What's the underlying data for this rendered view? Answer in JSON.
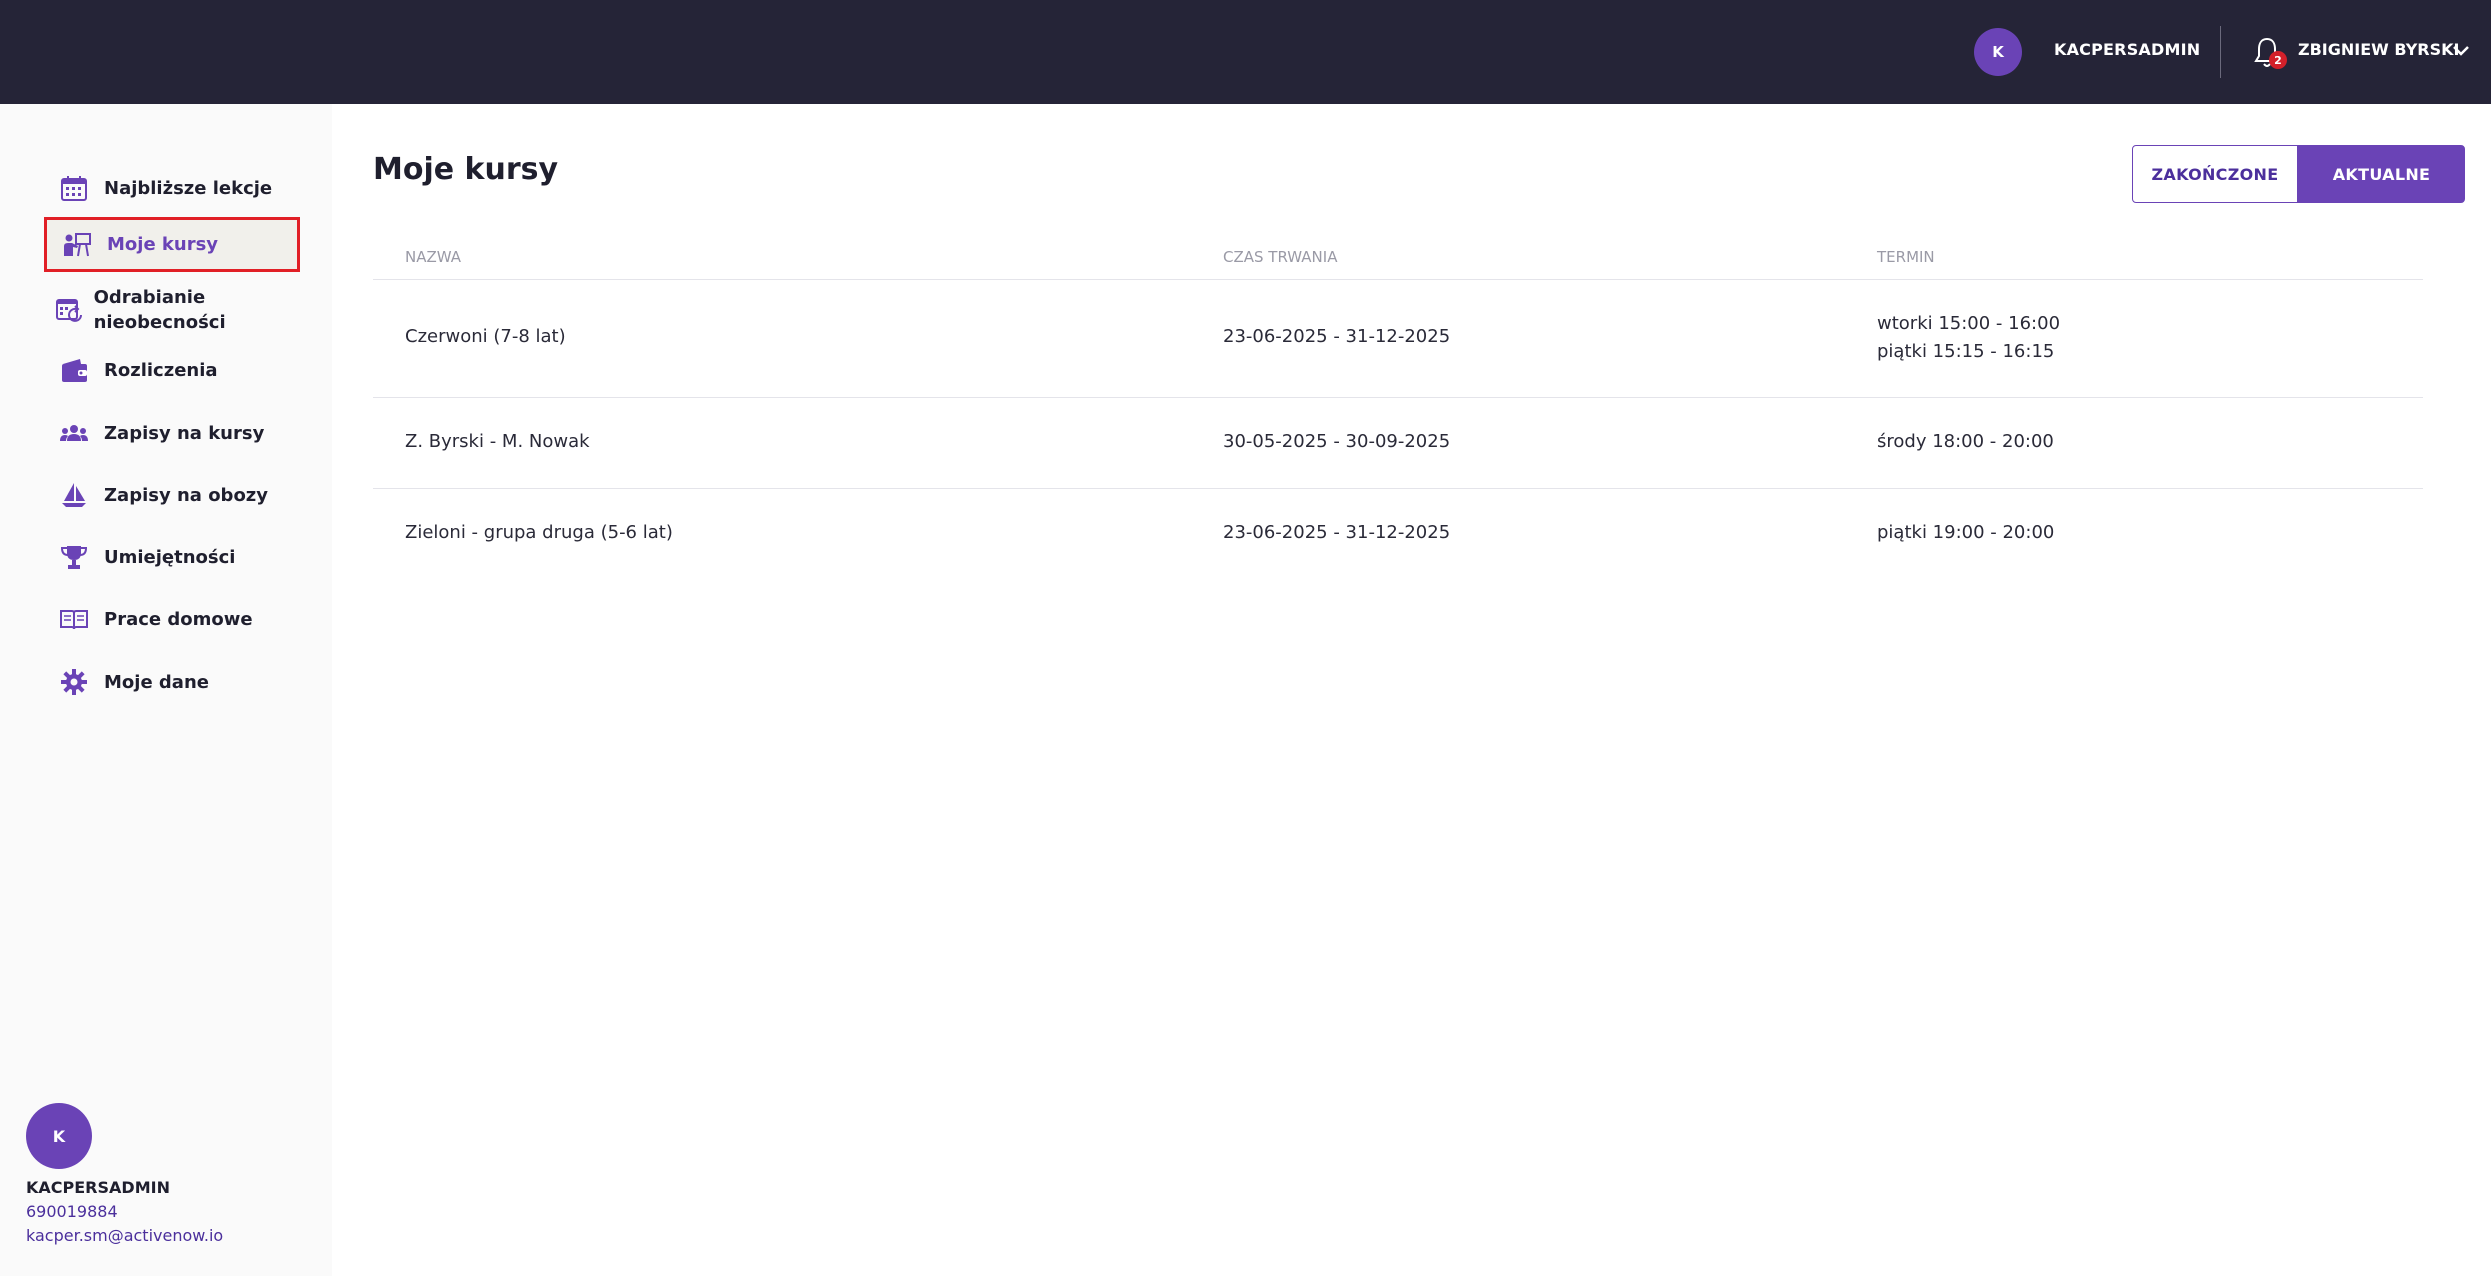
{
  "header": {
    "avatar_initial": "K",
    "user_name": "KACPERSADMIN",
    "notification_count": "2",
    "account_name": "ZBIGNIEW BYRSKI"
  },
  "sidebar": {
    "items": [
      {
        "label": "Najbliższe lekcje",
        "icon": "calendar-icon"
      },
      {
        "label": "Moje kursy",
        "icon": "teacher-board-icon"
      },
      {
        "label": "Odrabianie nieobecności",
        "icon": "calendar-refresh-icon"
      },
      {
        "label": "Rozliczenia",
        "icon": "wallet-icon"
      },
      {
        "label": "Zapisy na kursy",
        "icon": "group-icon"
      },
      {
        "label": "Zapisy na obozy",
        "icon": "sailboat-icon"
      },
      {
        "label": "Umiejętności",
        "icon": "trophy-icon"
      },
      {
        "label": "Prace domowe",
        "icon": "book-icon"
      },
      {
        "label": "Moje dane",
        "icon": "gear-icon"
      }
    ],
    "profile": {
      "initial": "K",
      "name": "KACPERSADMIN",
      "phone": "690019884",
      "email": "kacper.sm@activenow.io"
    }
  },
  "main": {
    "title": "Moje kursy",
    "tabs": {
      "finished": "ZAKOŃCZONE",
      "current": "AKTUALNE"
    },
    "columns": [
      "NAZWA",
      "CZAS TRWANIA",
      "TERMIN"
    ],
    "rows": [
      {
        "name": "Czerwoni (7-8 lat)",
        "duration": "23-06-2025 - 31-12-2025",
        "term": [
          "wtorki 15:00 - 16:00",
          "piątki 15:15 - 16:15"
        ]
      },
      {
        "name": "Z. Byrski - M. Nowak",
        "duration": "30-05-2025 - 30-09-2025",
        "term": [
          "środy 18:00 - 20:00"
        ]
      },
      {
        "name": "Zieloni - grupa druga (5-6 lat)",
        "duration": "23-06-2025 - 31-12-2025",
        "term": [
          "piątki 19:00 - 20:00"
        ]
      }
    ]
  },
  "colors": {
    "topbar": "#252437",
    "accent": "#6a43b6",
    "link": "#4b2f9c",
    "badge": "#d3202a",
    "highlight": "#e11f26"
  }
}
